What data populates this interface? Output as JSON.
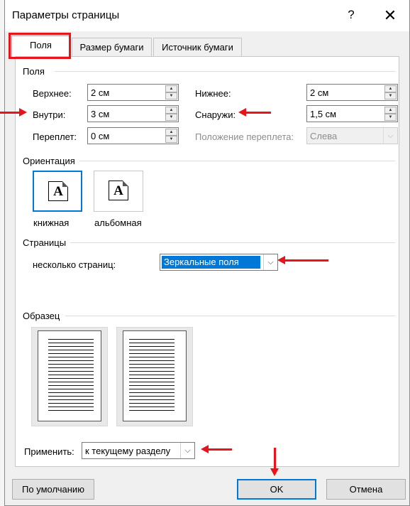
{
  "window": {
    "title": "Параметры страницы",
    "help_glyph": "?",
    "close_glyph": "✕"
  },
  "tabs": [
    "Поля",
    "Размер бумаги",
    "Источник бумаги"
  ],
  "margins": {
    "heading": "Поля",
    "top": {
      "label": "Верхнее:",
      "value": "2 см"
    },
    "bottom": {
      "label": "Нижнее:",
      "value": "2 см"
    },
    "inside": {
      "label": "Внутри:",
      "value": "3 см"
    },
    "outside": {
      "label": "Снаружи:",
      "value": "1,5 см"
    },
    "gutter": {
      "label": "Переплет:",
      "value": "0 см"
    },
    "gutter_pos": {
      "label": "Положение переплета:",
      "value": "Слева"
    }
  },
  "orientation": {
    "heading": "Ориентация",
    "portrait": {
      "label": "книжная",
      "glyph": "A"
    },
    "landscape": {
      "label": "альбомная",
      "glyph": "A"
    }
  },
  "pages": {
    "heading": "Страницы",
    "multiple_label": "несколько страниц:",
    "multiple_value": "Зеркальные поля"
  },
  "preview": {
    "heading": "Образец"
  },
  "apply": {
    "label": "Применить:",
    "value": "к текущему разделу"
  },
  "buttons": {
    "default": "По умолчанию",
    "ok": "OK",
    "cancel": "Отмена"
  },
  "icons": {
    "spin_up": "▲",
    "spin_down": "▼",
    "dropdown": "⌵"
  },
  "colors": {
    "annotation": "#e8141b",
    "accent": "#0078d7"
  }
}
